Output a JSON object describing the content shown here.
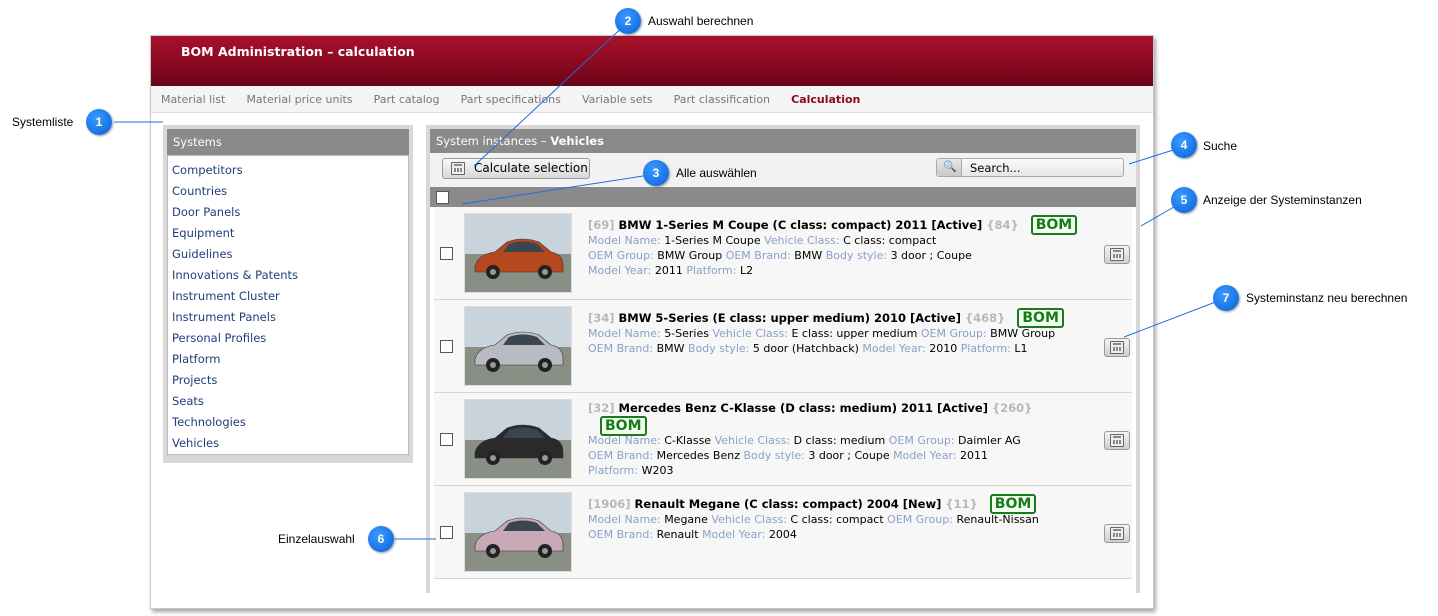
{
  "header": {
    "title": "BOM Administration – calculation"
  },
  "nav": {
    "tabs": [
      {
        "label": "Material list"
      },
      {
        "label": "Material price units"
      },
      {
        "label": "Part catalog"
      },
      {
        "label": "Part specifications"
      },
      {
        "label": "Variable sets"
      },
      {
        "label": "Part classification"
      },
      {
        "label": "Calculation"
      }
    ],
    "active": "Calculation"
  },
  "systems": {
    "header": "Systems",
    "items": [
      {
        "label": "Competitors"
      },
      {
        "label": "Countries"
      },
      {
        "label": "Door Panels"
      },
      {
        "label": "Equipment"
      },
      {
        "label": "Guidelines"
      },
      {
        "label": "Innovations & Patents"
      },
      {
        "label": "Instrument Cluster"
      },
      {
        "label": "Instrument Panels"
      },
      {
        "label": "Personal Profiles"
      },
      {
        "label": "Platform"
      },
      {
        "label": "Projects"
      },
      {
        "label": "Seats"
      },
      {
        "label": "Technologies"
      },
      {
        "label": "Vehicles"
      }
    ]
  },
  "instances": {
    "header_prefix": "System instances –",
    "header_name": "Vehicles",
    "calc_button": "Calculate selection",
    "search_placeholder": "Search...",
    "bom_badge": "BOM",
    "rows": [
      {
        "id": "[69]",
        "title": "BMW 1-Series M Coupe (C class: compact) 2011 [Active]",
        "count": "{84}",
        "l1": [
          [
            "Model Name:",
            "1-Series M Coupe"
          ],
          [
            "Vehicle Class:",
            "C class: compact"
          ]
        ],
        "l2": [
          [
            "OEM Group:",
            "BMW Group"
          ],
          [
            "OEM Brand:",
            "BMW"
          ],
          [
            "Body style:",
            "3 door ;  Coupe"
          ]
        ],
        "l3": [
          [
            "Model Year:",
            "2011"
          ],
          [
            "Platform:",
            "L2"
          ]
        ],
        "car_color": "#b5481f"
      },
      {
        "id": "[34]",
        "title": "BMW 5-Series (E class: upper medium) 2010 [Active]",
        "count": "{468}",
        "l1": [
          [
            "Model Name:",
            "5-Series"
          ],
          [
            "Vehicle Class:",
            "E class: upper medium"
          ],
          [
            "OEM Group:",
            "BMW Group"
          ]
        ],
        "l2": [
          [
            "OEM Brand:",
            "BMW"
          ],
          [
            "Body style:",
            "5 door (Hatchback)"
          ],
          [
            "Model Year:",
            "2010"
          ],
          [
            "Platform:",
            "L1"
          ]
        ],
        "l3": [],
        "car_color": "#b8bcc0"
      },
      {
        "id": "[32]",
        "title": "Mercedes Benz C-Klasse (D class: medium) 2011 [Active]",
        "count": "{260}",
        "l1": [
          [
            "Model Name:",
            "C-Klasse"
          ],
          [
            "Vehicle Class:",
            "D class: medium"
          ],
          [
            "OEM Group:",
            "Daimler AG"
          ]
        ],
        "l2": [
          [
            "OEM Brand:",
            "Mercedes Benz"
          ],
          [
            "Body style:",
            "3 door ;  Coupe"
          ],
          [
            "Model Year:",
            "2011"
          ]
        ],
        "l3": [
          [
            "Platform:",
            "W203"
          ]
        ],
        "car_color": "#2a2a2a"
      },
      {
        "id": "[1906]",
        "title": "Renault Megane (C class: compact) 2004 [New]",
        "count": "{11}",
        "l1": [
          [
            "Model Name:",
            "Megane"
          ],
          [
            "Vehicle Class:",
            "C class: compact"
          ],
          [
            "OEM Group:",
            "Renault-Nissan"
          ]
        ],
        "l2": [
          [
            "OEM Brand:",
            "Renault"
          ],
          [
            "Model Year:",
            "2004"
          ]
        ],
        "l3": [],
        "car_color": "#c8a8b4"
      }
    ]
  },
  "annotations": [
    {
      "num": "1",
      "label": "Systemliste"
    },
    {
      "num": "2",
      "label": "Auswahl berechnen"
    },
    {
      "num": "3",
      "label": "Alle auswählen"
    },
    {
      "num": "4",
      "label": "Suche"
    },
    {
      "num": "5",
      "label": "Anzeige der Systeminstanzen"
    },
    {
      "num": "6",
      "label": "Einzelauswahl"
    },
    {
      "num": "7",
      "label": "Systeminstanz neu berechnen"
    }
  ]
}
